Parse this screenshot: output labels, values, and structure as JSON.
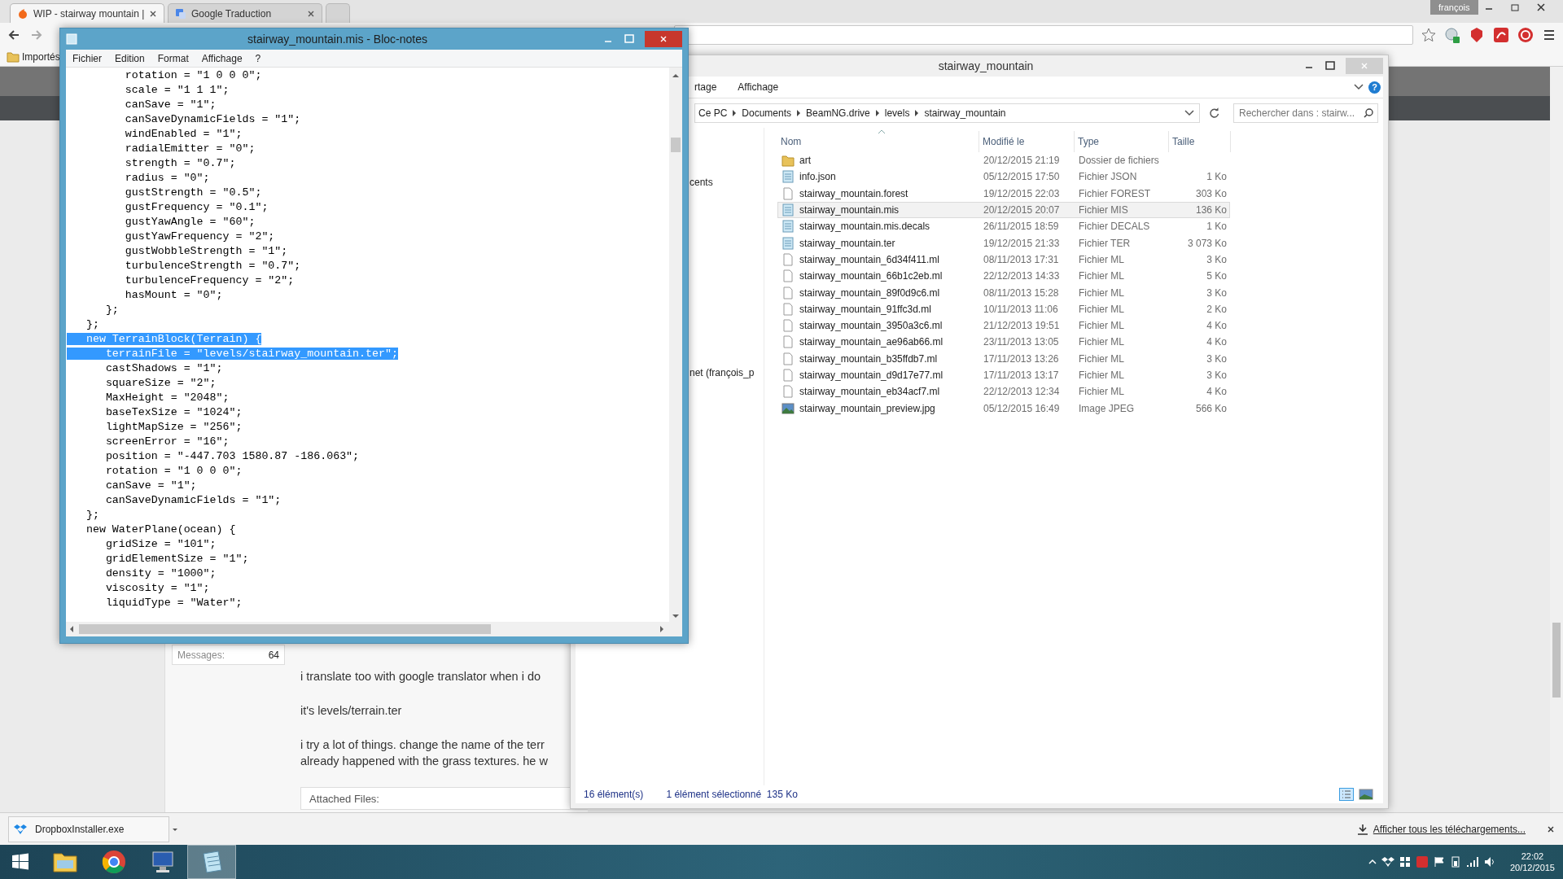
{
  "browser": {
    "tabs": [
      {
        "label": "WIP - stairway mountain |",
        "selected": true
      },
      {
        "label": "Google Traduction",
        "selected": false
      }
    ],
    "profile": "françois",
    "bookmark": "Importés"
  },
  "notepad": {
    "title": "stairway_mountain.mis - Bloc-notes",
    "menu": [
      "Fichier",
      "Edition",
      "Format",
      "Affichage",
      "?"
    ],
    "lines": [
      {
        "text": "         rotation = \"1 0 0 0\";",
        "selected": false
      },
      {
        "text": "         scale = \"1 1 1\";",
        "selected": false
      },
      {
        "text": "         canSave = \"1\";",
        "selected": false
      },
      {
        "text": "         canSaveDynamicFields = \"1\";",
        "selected": false
      },
      {
        "text": "         windEnabled = \"1\";",
        "selected": false
      },
      {
        "text": "         radialEmitter = \"0\";",
        "selected": false
      },
      {
        "text": "         strength = \"0.7\";",
        "selected": false
      },
      {
        "text": "         radius = \"0\";",
        "selected": false
      },
      {
        "text": "         gustStrength = \"0.5\";",
        "selected": false
      },
      {
        "text": "         gustFrequency = \"0.1\";",
        "selected": false
      },
      {
        "text": "         gustYawAngle = \"60\";",
        "selected": false
      },
      {
        "text": "         gustYawFrequency = \"2\";",
        "selected": false
      },
      {
        "text": "         gustWobbleStrength = \"1\";",
        "selected": false
      },
      {
        "text": "         turbulenceStrength = \"0.7\";",
        "selected": false
      },
      {
        "text": "         turbulenceFrequency = \"2\";",
        "selected": false
      },
      {
        "text": "         hasMount = \"0\";",
        "selected": false
      },
      {
        "text": "      };",
        "selected": false
      },
      {
        "text": "   };",
        "selected": false
      },
      {
        "text": "   new TerrainBlock(Terrain) {",
        "selected": true
      },
      {
        "text": "      terrainFile = \"levels/stairway_mountain.ter\";",
        "selected": true
      },
      {
        "text": "      castShadows = \"1\";",
        "selected": false
      },
      {
        "text": "      squareSize = \"2\";",
        "selected": false
      },
      {
        "text": "      MaxHeight = \"2048\";",
        "selected": false
      },
      {
        "text": "      baseTexSize = \"1024\";",
        "selected": false
      },
      {
        "text": "      lightMapSize = \"256\";",
        "selected": false
      },
      {
        "text": "      screenError = \"16\";",
        "selected": false
      },
      {
        "text": "      position = \"-447.703 1580.87 -186.063\";",
        "selected": false
      },
      {
        "text": "      rotation = \"1 0 0 0\";",
        "selected": false
      },
      {
        "text": "      canSave = \"1\";",
        "selected": false
      },
      {
        "text": "      canSaveDynamicFields = \"1\";",
        "selected": false
      },
      {
        "text": "   };",
        "selected": false
      },
      {
        "text": "   new WaterPlane(ocean) {",
        "selected": false
      },
      {
        "text": "      gridSize = \"101\";",
        "selected": false
      },
      {
        "text": "      gridElementSize = \"1\";",
        "selected": false
      },
      {
        "text": "      density = \"1000\";",
        "selected": false
      },
      {
        "text": "      viscosity = \"1\";",
        "selected": false
      },
      {
        "text": "      liquidType = \"Water\";",
        "selected": false
      }
    ]
  },
  "explorer": {
    "title": "stairway_mountain",
    "ribbon_tabs": [
      "rtage",
      "Affichage"
    ],
    "help": "?",
    "breadcrumb": [
      "Ce PC",
      "Documents",
      "BeamNG.drive",
      "levels",
      "stairway_mountain"
    ],
    "search": {
      "placeholder": "Rechercher dans : stairw..."
    },
    "nav_items": [
      "cents",
      "net (françois_p"
    ],
    "columns": [
      "Nom",
      "Modifié le",
      "Type",
      "Taille"
    ],
    "files": [
      {
        "name": "art",
        "modified": "20/12/2015 21:19",
        "type": "Dossier de fichiers",
        "kind": "folder",
        "selected": false
      },
      {
        "name": "info.json",
        "modified": "05/12/2015 17:50",
        "type": "Fichier JSON",
        "size": "1 Ko",
        "kind": "text",
        "selected": false
      },
      {
        "name": "stairway_mountain.forest",
        "modified": "19/12/2015 22:03",
        "type": "Fichier FOREST",
        "size": "303 Ko",
        "kind": "blank",
        "selected": false
      },
      {
        "name": "stairway_mountain.mis",
        "modified": "20/12/2015 20:07",
        "type": "Fichier MIS",
        "size": "136 Ko",
        "kind": "text",
        "selected": true
      },
      {
        "name": "stairway_mountain.mis.decals",
        "modified": "26/11/2015 18:59",
        "type": "Fichier DECALS",
        "size": "1 Ko",
        "kind": "text",
        "selected": false
      },
      {
        "name": "stairway_mountain.ter",
        "modified": "19/12/2015 21:33",
        "type": "Fichier TER",
        "size": "3 073 Ko",
        "kind": "text",
        "selected": false
      },
      {
        "name": "stairway_mountain_6d34f411.ml",
        "modified": "08/11/2013 17:31",
        "type": "Fichier ML",
        "size": "3 Ko",
        "kind": "blank",
        "selected": false
      },
      {
        "name": "stairway_mountain_66b1c2eb.ml",
        "modified": "22/12/2013 14:33",
        "type": "Fichier ML",
        "size": "5 Ko",
        "kind": "blank",
        "selected": false
      },
      {
        "name": "stairway_mountain_89f0d9c6.ml",
        "modified": "08/11/2013 15:28",
        "type": "Fichier ML",
        "size": "3 Ko",
        "kind": "blank",
        "selected": false
      },
      {
        "name": "stairway_mountain_91ffc3d.ml",
        "modified": "10/11/2013 11:06",
        "type": "Fichier ML",
        "size": "2 Ko",
        "kind": "blank",
        "selected": false
      },
      {
        "name": "stairway_mountain_3950a3c6.ml",
        "modified": "21/12/2013 19:51",
        "type": "Fichier ML",
        "size": "4 Ko",
        "kind": "blank",
        "selected": false
      },
      {
        "name": "stairway_mountain_ae96ab66.ml",
        "modified": "23/11/2013 13:05",
        "type": "Fichier ML",
        "size": "4 Ko",
        "kind": "blank",
        "selected": false
      },
      {
        "name": "stairway_mountain_b35ffdb7.ml",
        "modified": "17/11/2013 13:26",
        "type": "Fichier ML",
        "size": "3 Ko",
        "kind": "blank",
        "selected": false
      },
      {
        "name": "stairway_mountain_d9d17e77.ml",
        "modified": "17/11/2013 13:17",
        "type": "Fichier ML",
        "size": "3 Ko",
        "kind": "blank",
        "selected": false
      },
      {
        "name": "stairway_mountain_eb34acf7.ml",
        "modified": "22/12/2013 12:34",
        "type": "Fichier ML",
        "size": "4 Ko",
        "kind": "blank",
        "selected": false
      },
      {
        "name": "stairway_mountain_preview.jpg",
        "modified": "05/12/2015 16:49",
        "type": "Image JPEG",
        "size": "566 Ko",
        "kind": "image",
        "selected": false
      }
    ],
    "status": {
      "count": "16 élément(s)",
      "selection": "1 élément sélectionné  135 Ko"
    }
  },
  "forum": {
    "stat": {
      "label": "Messages:",
      "value": "64"
    },
    "paragraphs": [
      [
        "i translate too with google translator when i do"
      ],
      [
        "it's levels/terrain.ter"
      ],
      [
        "i try a lot of things. change the name of the terr",
        "already happened with the grass textures. he w"
      ]
    ],
    "attachments_label": "Attached Files:"
  },
  "downloads": {
    "file": "DropboxInstaller.exe",
    "show_all": "Afficher tous les téléchargements..."
  },
  "taskbar": {
    "apps": [
      {
        "kind": "folder",
        "active": false
      },
      {
        "kind": "browser",
        "active": false
      },
      {
        "kind": "computer",
        "active": false
      },
      {
        "kind": "notepad",
        "active": true
      }
    ],
    "time": "22:02",
    "date": "20/12/2015"
  }
}
